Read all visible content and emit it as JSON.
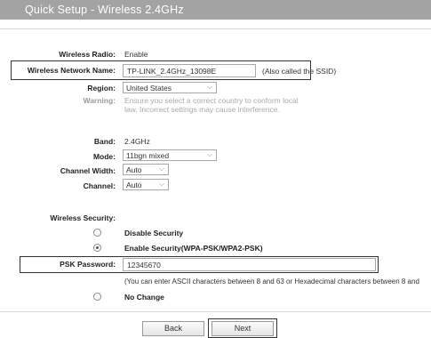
{
  "header": {
    "title": "Quick Setup - Wireless 2.4GHz"
  },
  "form": {
    "wireless_radio": {
      "label": "Wireless Radio:",
      "value": "Enable"
    },
    "network_name": {
      "label": "Wireless Network Name:",
      "value": "TP-LINK_2.4GHz_13098E",
      "hint": "(Also called the SSID)"
    },
    "region": {
      "label": "Region:",
      "value": "United States"
    },
    "warning": {
      "label": "Warning:",
      "text": "Ensure you select a correct country to conform local law. Incorrect settings may cause interference."
    },
    "band": {
      "label": "Band:",
      "value": "2.4GHz"
    },
    "mode": {
      "label": "Mode:",
      "value": "11bgn mixed"
    },
    "channel_width": {
      "label": "Channel Width:",
      "value": "Auto"
    },
    "channel": {
      "label": "Channel:",
      "value": "Auto"
    },
    "security": {
      "label": "Wireless Security:",
      "options": [
        {
          "label": "Disable Security",
          "selected": false
        },
        {
          "label": "Enable Security(WPA-PSK/WPA2-PSK)",
          "selected": true
        },
        {
          "label": "No Change",
          "selected": false
        }
      ]
    },
    "psk": {
      "label": "PSK Password:",
      "value": "12345670",
      "hint": "(You can enter ASCII characters between 8 and 63 or Hexadecimal characters between 8 and"
    }
  },
  "buttons": {
    "back": "Back",
    "next": "Next"
  },
  "icons": {
    "dropdown": "chevron-down-icon",
    "radio": "radio-button-icon"
  }
}
